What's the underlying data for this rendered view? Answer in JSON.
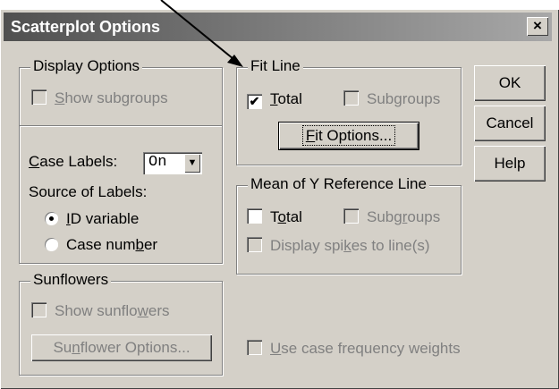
{
  "window": {
    "title": "Scatterplot Options",
    "close_glyph": "×"
  },
  "display_options": {
    "legend": "Display Options",
    "show_subgroups": {
      "pre": "",
      "ul": "S",
      "post": "how subgroups",
      "checked": false,
      "enabled": false
    }
  },
  "case_labels": {
    "label_pre": "",
    "label_ul": "C",
    "label_post": "ase Labels:",
    "select_value": "On",
    "source_label": "Source of Labels:",
    "id_variable": {
      "pre": "",
      "ul": "I",
      "post": "D variable",
      "selected": true
    },
    "case_number": {
      "pre": "Case num",
      "ul": "b",
      "post": "er",
      "selected": false
    }
  },
  "sunflowers": {
    "legend": "Sunflowers",
    "show_sunflowers": {
      "pre": "Show sunflo",
      "ul": "w",
      "post": "ers",
      "checked": false,
      "enabled": false
    },
    "options_button": {
      "pre": "Su",
      "ul": "n",
      "post": "flower Options..."
    }
  },
  "fit_line": {
    "legend": "Fit Line",
    "total": {
      "pre": "",
      "ul": "T",
      "post": "otal",
      "checked": true,
      "enabled": true
    },
    "subgroups": {
      "pre": "Sub",
      "ul": "g",
      "post": "roups",
      "checked": false,
      "enabled": false
    },
    "fit_options_button": {
      "pre": "",
      "ul": "F",
      "post": "it Options..."
    }
  },
  "mean_y": {
    "legend": "Mean of Y Reference Line",
    "total": {
      "pre": "T",
      "ul": "o",
      "post": "tal",
      "checked": false,
      "enabled": true
    },
    "subgroups": {
      "pre": "Subg",
      "ul": "r",
      "post": "oups",
      "checked": false,
      "enabled": false
    },
    "display_spikes": {
      "pre": "Display spi",
      "ul": "k",
      "post": "es to line(s)",
      "checked": false,
      "enabled": false
    }
  },
  "case_frequency": {
    "pre": "",
    "ul": "U",
    "post": "se case frequency weights",
    "checked": false,
    "enabled": false
  },
  "buttons": {
    "ok": "OK",
    "cancel": "Cancel",
    "help": "Help"
  },
  "icons": {
    "check": "✔",
    "dropdown": "▼"
  }
}
